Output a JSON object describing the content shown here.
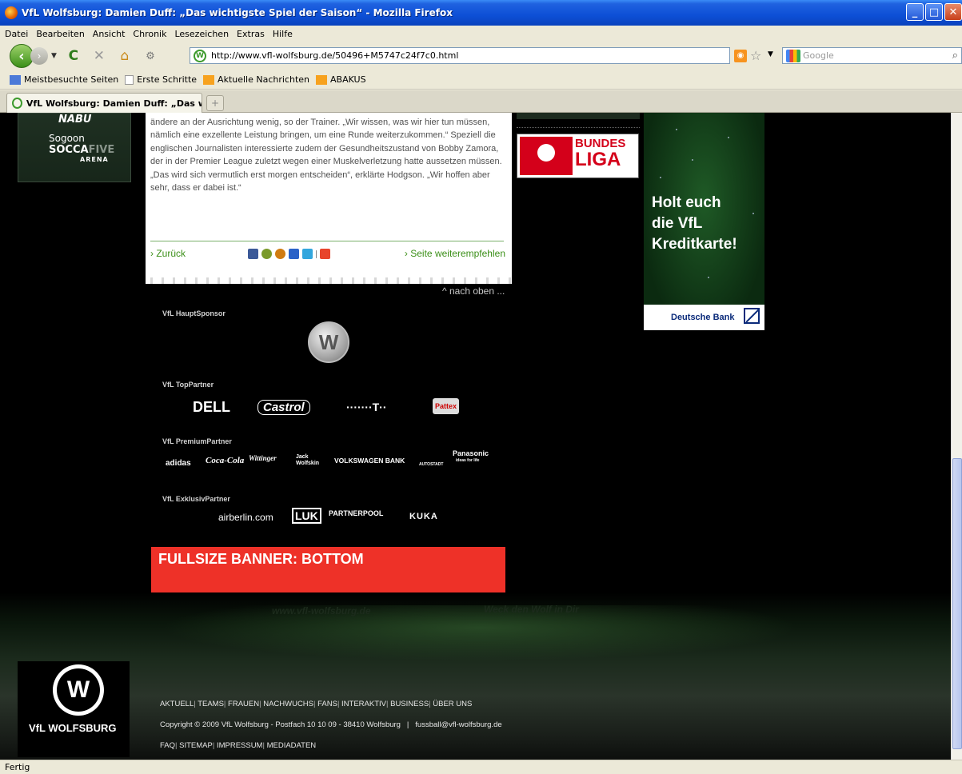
{
  "window": {
    "title": "VfL Wolfsburg: Damien Duff: „Das wichtigste Spiel der Saison“ - Mozilla Firefox"
  },
  "menu": [
    "Datei",
    "Bearbeiten",
    "Ansicht",
    "Chronik",
    "Lesezeichen",
    "Extras",
    "Hilfe"
  ],
  "toolbar": {
    "url": "http://www.vfl-wolfsburg.de/50496+M5747c24f7c0.html",
    "search_placeholder": "Google"
  },
  "bookmarks": [
    "Meistbesuchte Seiten",
    "Erste Schritte",
    "Aktuelle Nachrichten",
    "ABAKUS"
  ],
  "tab": {
    "title": "VfL Wolfsburg: Damien Duff: „Das wic...",
    "new_tab_symbol": "+"
  },
  "left_banner": {
    "nabu": "NABU",
    "line1": "Sogoon",
    "line2a": "SOCCA",
    "line2b": "FIVE",
    "line3": "ARENA"
  },
  "article": {
    "body": "ändere an der Ausrichtung wenig, so der Trainer. „Wir wissen, was wir hier tun müssen, nämlich eine exzellente Leistung bringen, um eine Runde weiterzukommen.“ Speziell die englischen Journalisten interessierte zudem der Gesundheitszustand von Bobby Zamora, der in der Premier League zuletzt wegen einer Muskelverletzung hatte aussetzen müssen. „Das wird sich vermutlich erst morgen entscheiden“, erklärte Hodgson. „Wir hoffen aber sehr, dass er dabei ist.“",
    "back": "› Zurück",
    "recommend": "› Seite weiterempfehlen"
  },
  "nach_oben": "^ nach oben ...",
  "bundesliga": {
    "line1": "BUNDES",
    "line2": "LIGA"
  },
  "bank_ad": {
    "line1": "Holt euch",
    "line2": "die VfL",
    "line3": "Kreditkarte!",
    "bank": "Deutsche Bank"
  },
  "sponsors": {
    "main_label": "VfL HauptSponsor",
    "top_label": "VfL TopPartner",
    "premium_label": "VfL PremiumPartner",
    "exclusive_label": "VfL ExklusivPartner",
    "top": [
      "DELL",
      "Castrol",
      "·······T··",
      "Pattex"
    ],
    "premium": [
      "adidas",
      "Coca-Cola",
      "Wittinger",
      "Jack Wolfskin",
      "VOLKSWAGEN BANK",
      "AUTOSTADT",
      "Panasonic"
    ],
    "premium_sub": "ideas for life",
    "exclusive": [
      "airberlin.com",
      "LUK",
      "PARTNERPOOL",
      "KUKA"
    ]
  },
  "banner_bottom": "FULLSIZE BANNER: BOTTOM",
  "ghost_text": {
    "left": "www.vfl-wolfsburg.de",
    "right": "Weck den Wolf in Dir"
  },
  "club": {
    "crest": "W",
    "name": "VfL WOLFSBURG"
  },
  "footer": {
    "nav": [
      "AKTUELL",
      "TEAMS",
      "FRAUEN",
      "NACHWUCHS",
      "FANS",
      "INTERAKTIV",
      "BUSINESS",
      "ÜBER UNS"
    ],
    "copyright": "Copyright © 2009 VfL Wolfsburg - Postfach 10 10 09 - 38410 Wolfsburg   |   fussball@vfl-wolfsburg.de",
    "links": [
      "FAQ",
      "SITEMAP",
      "IMPRESSUM",
      "MEDIADATEN"
    ]
  },
  "status": "Fertig",
  "colors": {
    "accent_green": "#3b8f18",
    "banner_red": "#ee3128",
    "titlebar_blue": "#0d4fd6"
  }
}
